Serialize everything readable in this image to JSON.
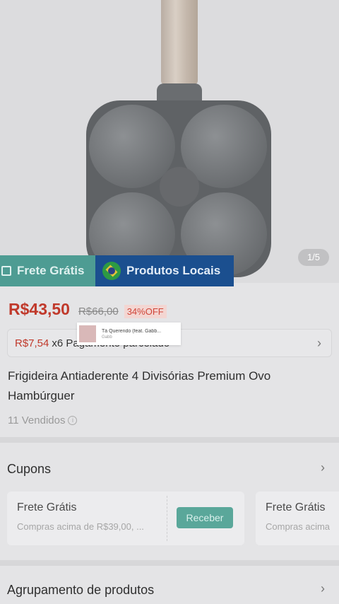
{
  "gallery": {
    "counter": "1/5"
  },
  "badges": {
    "frete_gratis": "Frete Grátis",
    "produtos_locais": "Produtos Locais"
  },
  "price": {
    "current": "R$43,50",
    "original": "R$66,00",
    "discount": "34%OFF"
  },
  "installment": {
    "amount": "R$7,54",
    "text": "x6 Pagamento parcelado"
  },
  "music_popup": {
    "title": "Tá Querendo (feat. Gabb...",
    "artist": "Gabb"
  },
  "product": {
    "title": "Frigideira Antiaderente 4 Divisórias Premium Ovo Hambúrguer",
    "sold": "11 Vendidos"
  },
  "coupons": {
    "header": "Cupons",
    "items": [
      {
        "title": "Frete Grátis",
        "description": "Compras acima de R$39,00, ...",
        "button": "Receber"
      },
      {
        "title": "Frete Grátis",
        "description": "Compras acima"
      }
    ]
  },
  "grouping": {
    "header": "Agrupamento de produtos"
  },
  "colors": {
    "price": "#c0392b",
    "frete_badge": "#4e9c93",
    "locais_badge": "#1b4f8f",
    "receive_button": "#5aa79a"
  }
}
